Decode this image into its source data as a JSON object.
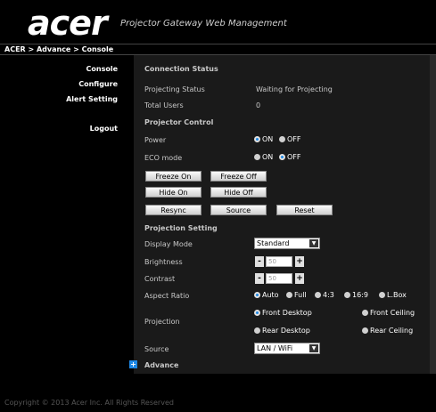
{
  "brand": {
    "logo": "acer",
    "tagline": "Projector Gateway Web Management"
  },
  "breadcrumb": "ACER > Advance > Console",
  "sidebar": {
    "items": [
      {
        "label": "Console"
      },
      {
        "label": "Configure"
      },
      {
        "label": "Alert Setting"
      },
      {
        "label": "Logout"
      }
    ]
  },
  "connection": {
    "title": "Connection Status",
    "projecting_label": "Projecting Status",
    "projecting_value": "Waiting for Projecting",
    "users_label": "Total Users",
    "users_value": "0"
  },
  "control": {
    "title": "Projector Control",
    "power_label": "Power",
    "eco_label": "ECO mode",
    "on": "ON",
    "off": "OFF",
    "power_selected": "ON",
    "eco_selected": "OFF",
    "buttons": {
      "freeze_on": "Freeze On",
      "freeze_off": "Freeze Off",
      "hide_on": "Hide On",
      "hide_off": "Hide Off",
      "resync": "Resync",
      "source": "Source",
      "reset": "Reset"
    }
  },
  "projection_setting": {
    "title": "Projection Setting",
    "display_mode_label": "Display Mode",
    "display_mode_value": "Standard",
    "brightness_label": "Brightness",
    "brightness_value": "50",
    "contrast_label": "Contrast",
    "contrast_value": "50",
    "minus": "-",
    "plus": "+",
    "aspect_label": "Aspect Ratio",
    "aspect_options": [
      "Auto",
      "Full",
      "4:3",
      "16:9",
      "L.Box"
    ],
    "aspect_selected": "Auto",
    "projection_label": "Projection",
    "projection_options": [
      "Front Desktop",
      "Front Ceiling",
      "Rear Desktop",
      "Rear Ceiling"
    ],
    "projection_selected": "Front Desktop",
    "source_label": "Source",
    "source_value": "LAN / WiFi"
  },
  "advance_label": "Advance",
  "copyright": "Copyright © 2013 Acer Inc. All Rights Reserved",
  "colors": {
    "accent": "#1e88e5",
    "background": "#000000",
    "panel": "#1a1a1a"
  }
}
